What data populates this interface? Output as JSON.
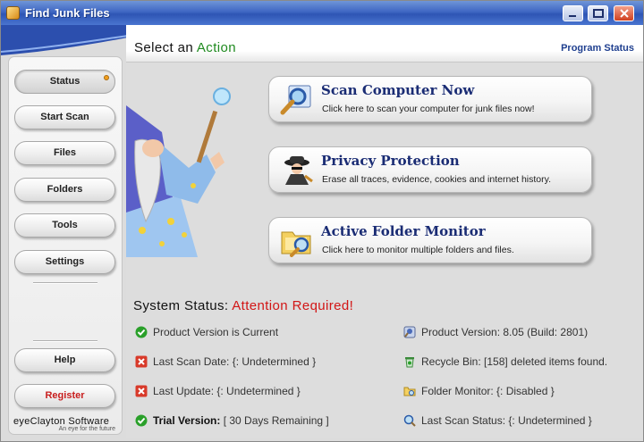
{
  "window": {
    "title": "Find Junk Files"
  },
  "header": {
    "title_prefix": "Select an ",
    "title_accent": "Action",
    "program_status": "Program Status"
  },
  "sidebar": {
    "items": [
      {
        "label": "Status"
      },
      {
        "label": "Start Scan"
      },
      {
        "label": "Files"
      },
      {
        "label": "Folders"
      },
      {
        "label": "Tools"
      },
      {
        "label": "Settings"
      }
    ],
    "help": "Help",
    "register": "Register",
    "brand": "eyeClayton Software",
    "tagline": "An eye for the future"
  },
  "actions": [
    {
      "title": "Scan Computer Now",
      "desc": "Click here to scan your computer for junk files now!",
      "icon": "magnifier-icon"
    },
    {
      "title": "Privacy Protection",
      "desc": "Erase all traces, evidence, cookies and internet history.",
      "icon": "spy-icon"
    },
    {
      "title": "Active Folder Monitor",
      "desc": "Click here to monitor multiple folders and files.",
      "icon": "folder-monitor-icon"
    }
  ],
  "system_status": {
    "title_prefix": "System Status: ",
    "title_alert": "Attention Required!",
    "left": [
      {
        "text": "Product Version is Current",
        "icon": "check-icon"
      },
      {
        "text": "Last Scan Date: {: Undetermined }",
        "icon": "error-icon"
      },
      {
        "text": "Last Update: {: Undetermined }",
        "icon": "error-icon"
      },
      {
        "label": "Trial Version:",
        "value": " [ 30 Days Remaining ]",
        "icon": "check-icon"
      }
    ],
    "right": [
      {
        "text": "Product Version: 8.05  (Build: 2801)",
        "icon": "product-icon"
      },
      {
        "text": "Recycle Bin: [158] deleted items found.",
        "icon": "recycle-bin-icon"
      },
      {
        "text": "Folder Monitor: {: Disabled }",
        "icon": "folder-monitor-small-icon"
      },
      {
        "text": "Last Scan Status: {: Undetermined }",
        "icon": "scan-status-icon"
      }
    ]
  },
  "colors": {
    "accent_green": "#1f8a1f",
    "alert_red": "#d21616",
    "title_blue": "#1a2c74"
  }
}
